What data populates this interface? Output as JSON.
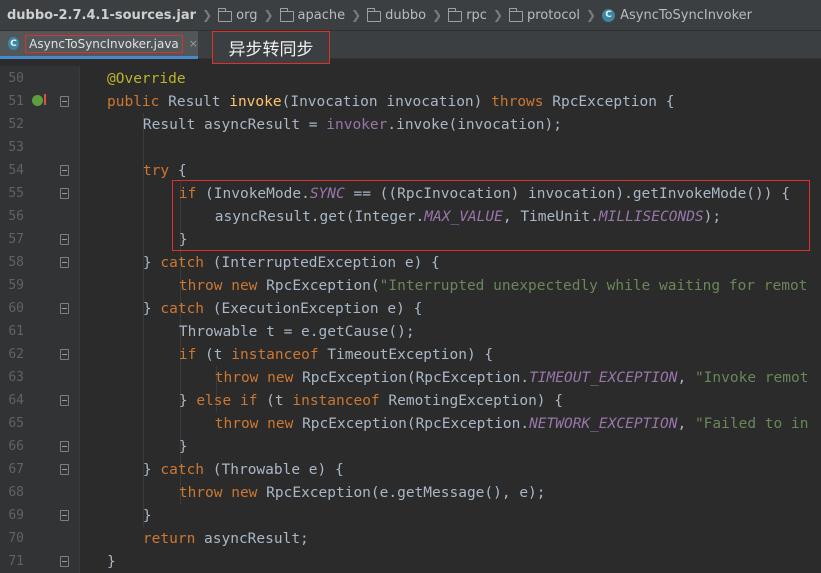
{
  "breadcrumb": {
    "root": "dubbo-2.7.4.1-sources.jar",
    "folders": [
      "org",
      "apache",
      "dubbo",
      "rpc",
      "protocol"
    ],
    "current": "AsyncToSyncInvoker"
  },
  "tab": {
    "label": "AsyncToSyncInvoker.java",
    "close": "×"
  },
  "annotation": "异步转同步",
  "class_icon_letter": "C",
  "colors": {
    "keyword": "#cc7832",
    "annotation": "#bbb529",
    "method": "#ffc66d",
    "field": "#9876aa",
    "string": "#6a8759",
    "default": "#a9b7c6",
    "highlight": "#e0302a"
  },
  "lines": [
    {
      "n": "50",
      "t": [
        [
          "ann",
          "@Override"
        ]
      ],
      "indent": 4
    },
    {
      "n": "51",
      "t": [
        [
          "kw",
          "public "
        ],
        [
          "",
          "Result "
        ],
        [
          "fn",
          "invoke"
        ],
        [
          "",
          "(Invocation invocation) "
        ],
        [
          "kw",
          "throws "
        ],
        [
          "",
          "RpcException {"
        ]
      ],
      "indent": 4
    },
    {
      "n": "52",
      "t": [
        [
          "",
          "Result asyncResult = "
        ],
        [
          "fld",
          "invoker"
        ],
        [
          "",
          ".invoke(invocation);"
        ]
      ],
      "indent": 8
    },
    {
      "n": "53",
      "t": [],
      "indent": 0
    },
    {
      "n": "54",
      "t": [
        [
          "kw",
          "try "
        ],
        [
          "",
          "{"
        ]
      ],
      "indent": 8
    },
    {
      "n": "55",
      "t": [
        [
          "kw",
          "if "
        ],
        [
          "",
          "(InvokeMode."
        ],
        [
          "st",
          "SYNC"
        ],
        [
          "",
          " == ((RpcInvocation) invocation).getInvokeMode()) {"
        ]
      ],
      "indent": 12
    },
    {
      "n": "56",
      "t": [
        [
          "",
          "asyncResult.get(Integer."
        ],
        [
          "st",
          "MAX_VALUE"
        ],
        [
          "",
          ", TimeUnit."
        ],
        [
          "st",
          "MILLISECONDS"
        ],
        [
          "",
          ");"
        ]
      ],
      "indent": 16
    },
    {
      "n": "57",
      "t": [
        [
          "",
          "}"
        ]
      ],
      "indent": 12
    },
    {
      "n": "58",
      "t": [
        [
          "",
          "} "
        ],
        [
          "kw",
          "catch "
        ],
        [
          "",
          "(InterruptedException e) {"
        ]
      ],
      "indent": 8
    },
    {
      "n": "59",
      "t": [
        [
          "kw",
          "throw new "
        ],
        [
          "",
          "RpcException("
        ],
        [
          "str",
          "\"Interrupted unexpectedly while waiting for remot"
        ]
      ],
      "indent": 12
    },
    {
      "n": "60",
      "t": [
        [
          "",
          "} "
        ],
        [
          "kw",
          "catch "
        ],
        [
          "",
          "(ExecutionException e) {"
        ]
      ],
      "indent": 8
    },
    {
      "n": "61",
      "t": [
        [
          "",
          "Throwable t = e.getCause();"
        ]
      ],
      "indent": 12
    },
    {
      "n": "62",
      "t": [
        [
          "kw",
          "if "
        ],
        [
          "",
          "(t "
        ],
        [
          "kw",
          "instanceof "
        ],
        [
          "",
          "TimeoutException) {"
        ]
      ],
      "indent": 12
    },
    {
      "n": "63",
      "t": [
        [
          "kw",
          "throw new "
        ],
        [
          "",
          "RpcException(RpcException."
        ],
        [
          "st",
          "TIMEOUT_EXCEPTION"
        ],
        [
          "",
          ", "
        ],
        [
          "str",
          "\"Invoke remot"
        ]
      ],
      "indent": 16
    },
    {
      "n": "64",
      "t": [
        [
          "",
          "} "
        ],
        [
          "kw",
          "else if "
        ],
        [
          "",
          "(t "
        ],
        [
          "kw",
          "instanceof "
        ],
        [
          "",
          "RemotingException) {"
        ]
      ],
      "indent": 12
    },
    {
      "n": "65",
      "t": [
        [
          "kw",
          "throw new "
        ],
        [
          "",
          "RpcException(RpcException."
        ],
        [
          "st",
          "NETWORK_EXCEPTION"
        ],
        [
          "",
          ", "
        ],
        [
          "str",
          "\"Failed to in"
        ]
      ],
      "indent": 16
    },
    {
      "n": "66",
      "t": [
        [
          "",
          "}"
        ]
      ],
      "indent": 12
    },
    {
      "n": "67",
      "t": [
        [
          "",
          "} "
        ],
        [
          "kw",
          "catch "
        ],
        [
          "",
          "(Throwable e) {"
        ]
      ],
      "indent": 8
    },
    {
      "n": "68",
      "t": [
        [
          "kw",
          "throw new "
        ],
        [
          "",
          "RpcException(e.getMessage(), e);"
        ]
      ],
      "indent": 12
    },
    {
      "n": "69",
      "t": [
        [
          "",
          "}"
        ]
      ],
      "indent": 8
    },
    {
      "n": "70",
      "t": [
        [
          "kw",
          "return "
        ],
        [
          "",
          "asyncResult;"
        ]
      ],
      "indent": 8
    },
    {
      "n": "71",
      "t": [
        [
          "",
          "}"
        ]
      ],
      "indent": 4
    }
  ]
}
